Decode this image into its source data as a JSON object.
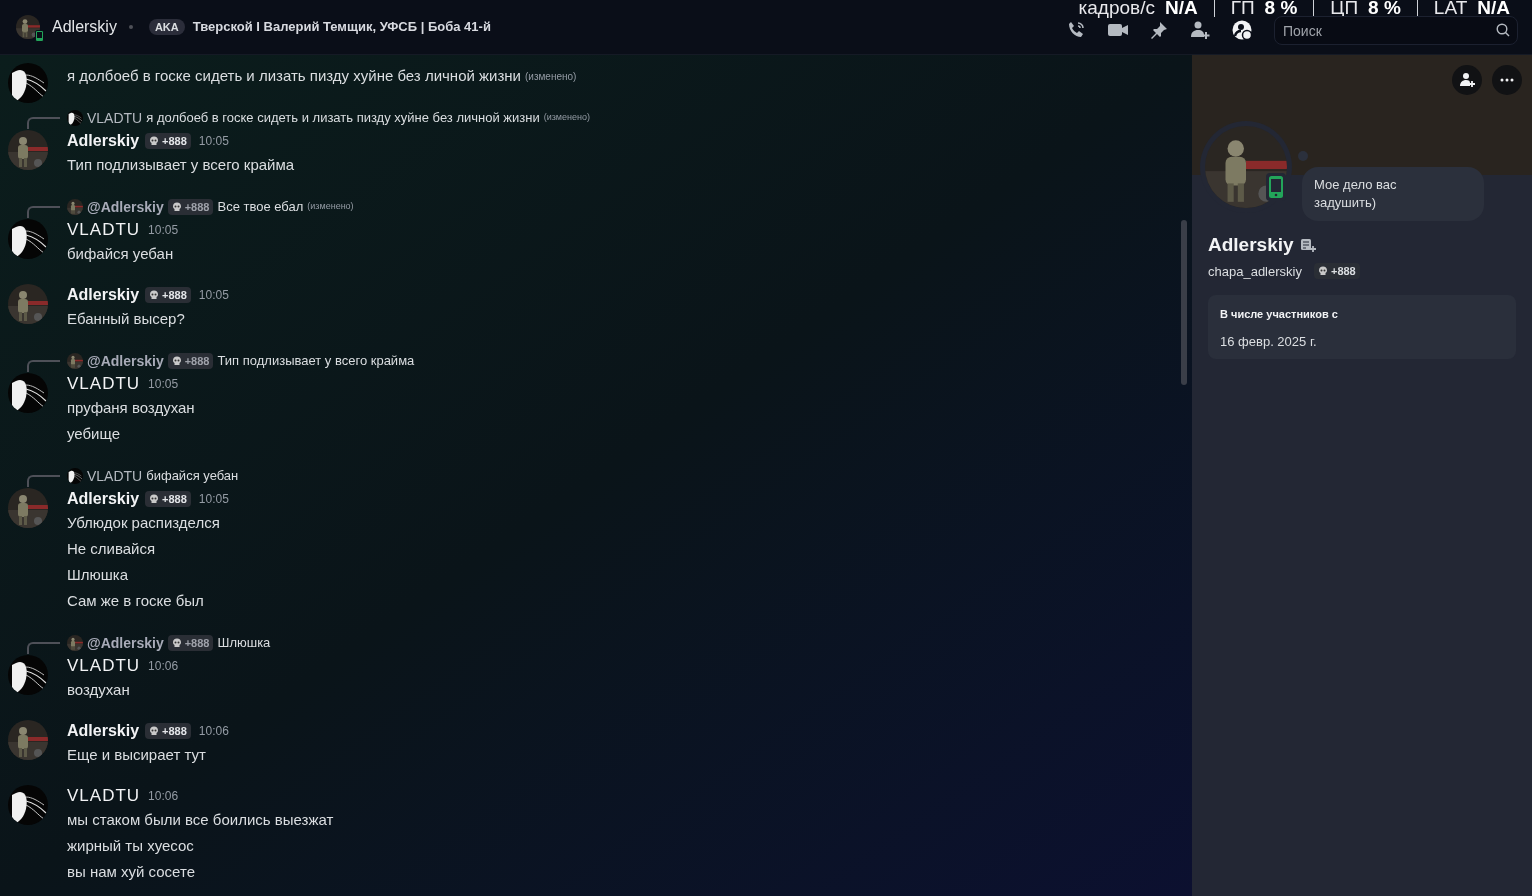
{
  "header": {
    "name": "Adlerskiy",
    "tag": "AKA",
    "status": "Тверской I Валерий Темщик, УФСБ | Боба 41-й",
    "search": {
      "placeholder": "Поиск"
    },
    "stats": [
      {
        "label": "кадров/с",
        "value": "N/A"
      },
      {
        "label": "ГП",
        "value": "8 %"
      },
      {
        "label": "ЦП",
        "value": "8 %"
      },
      {
        "label": "LAT",
        "value": "N/A"
      }
    ]
  },
  "messages": [
    {
      "kind": "continuation",
      "avatar": {
        "kind": "hair"
      },
      "lines": [
        "я долбоеб в госке сидеть и лизать пизду хуйне без личной жизни"
      ],
      "edited": "(изменено)"
    },
    {
      "kind": "full",
      "avatar": {
        "kind": "soldier"
      },
      "author": "Adlerskiy",
      "badge": "+888",
      "time": "10:05",
      "reply": {
        "avatar": {
          "kind": "hair"
        },
        "author": "VLADTU",
        "text": "я долбоеб в госке сидеть и лизать пизду хуйне без личной жизни",
        "edited": "(изменено)"
      },
      "lines": [
        "Тип подлизывает у всего крайма"
      ]
    },
    {
      "kind": "full",
      "avatar": {
        "kind": "hair"
      },
      "author": "VLADTU",
      "time": "10:05",
      "reply": {
        "avatar": {
          "kind": "soldier"
        },
        "author": "@Adlerskiy",
        "badge": "+888",
        "text": "Все твое ебал",
        "edited": "(изменено)"
      },
      "lines": [
        "бифайся уебан"
      ]
    },
    {
      "kind": "full",
      "avatar": {
        "kind": "soldier"
      },
      "author": "Adlerskiy",
      "badge": "+888",
      "time": "10:05",
      "lines": [
        "Ебанный высер?"
      ]
    },
    {
      "kind": "full",
      "avatar": {
        "kind": "hair"
      },
      "author": "VLADTU",
      "time": "10:05",
      "reply": {
        "avatar": {
          "kind": "soldier"
        },
        "author": "@Adlerskiy",
        "badge": "+888",
        "text": "Тип подлизывает у всего крайма"
      },
      "lines": [
        "пруфаня воздухан",
        "уебище"
      ]
    },
    {
      "kind": "full",
      "avatar": {
        "kind": "soldier"
      },
      "author": "Adlerskiy",
      "badge": "+888",
      "time": "10:05",
      "reply": {
        "avatar": {
          "kind": "hair"
        },
        "author": "VLADTU",
        "text": "бифайся уебан"
      },
      "lines": [
        "Ублюдок распизделся",
        "Не сливайся",
        "Шлюшка",
        "Сам же в госке был"
      ]
    },
    {
      "kind": "full",
      "avatar": {
        "kind": "hair"
      },
      "author": "VLADTU",
      "time": "10:06",
      "reply": {
        "avatar": {
          "kind": "soldier"
        },
        "author": "@Adlerskiy",
        "badge": "+888",
        "text": "Шлюшка"
      },
      "lines": [
        "воздухан"
      ]
    },
    {
      "kind": "full",
      "avatar": {
        "kind": "soldier"
      },
      "author": "Adlerskiy",
      "badge": "+888",
      "time": "10:06",
      "lines": [
        "Еще и высирает тут"
      ]
    },
    {
      "kind": "full",
      "avatar": {
        "kind": "hair"
      },
      "author": "VLADTU",
      "time": "10:06",
      "lines": [
        "мы стаком были все боились выезжат",
        "жирный ты хуесос",
        "вы нам хуй сосете"
      ]
    }
  ],
  "profile": {
    "name": "Adlerskiy",
    "username": "chapa_adlerskiy",
    "badge": "+888",
    "status": "Мое дело вас задушить)",
    "member_label": "В числе участников с",
    "member_since": "16 февр. 2025 г."
  }
}
